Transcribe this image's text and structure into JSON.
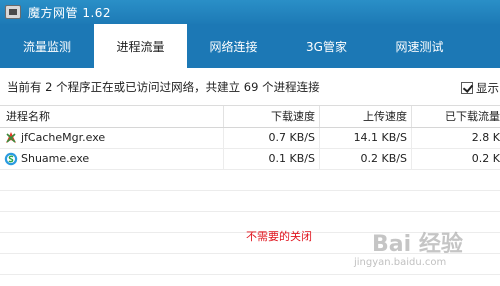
{
  "window": {
    "title": "魔方网管 1.62"
  },
  "tabs": [
    {
      "label": "流量监测",
      "active": false
    },
    {
      "label": "进程流量",
      "active": true
    },
    {
      "label": "网络连接",
      "active": false
    },
    {
      "label": "3G管家",
      "active": false
    },
    {
      "label": "网速测试",
      "active": false
    }
  ],
  "info": {
    "summary": "当前有 2 个程序正在或已访问过网络，共建立 69 个进程连接",
    "show_label": "显示",
    "show_checked": true
  },
  "table": {
    "columns": [
      "进程名称",
      "下载速度",
      "上传速度",
      "已下载流量"
    ],
    "rows": [
      {
        "icon": "jfcache-process-icon",
        "name": "jfCacheMgr.exe",
        "download": "0.7 KB/S",
        "upload": "14.1 KB/S",
        "downloaded": "2.8 K"
      },
      {
        "icon": "shuame-process-icon",
        "name": "Shuame.exe",
        "download": "0.1 KB/S",
        "upload": "0.2 KB/S",
        "downloaded": "0.2 K"
      }
    ]
  },
  "annotation": "不需要的关闭",
  "watermark": {
    "main": "Bai 经验",
    "sub": "jingyan.baidu.com"
  },
  "colors": {
    "titlebar": "#2a8fc7",
    "tabbar": "#1c78b5",
    "annotation": "#e0141e"
  }
}
